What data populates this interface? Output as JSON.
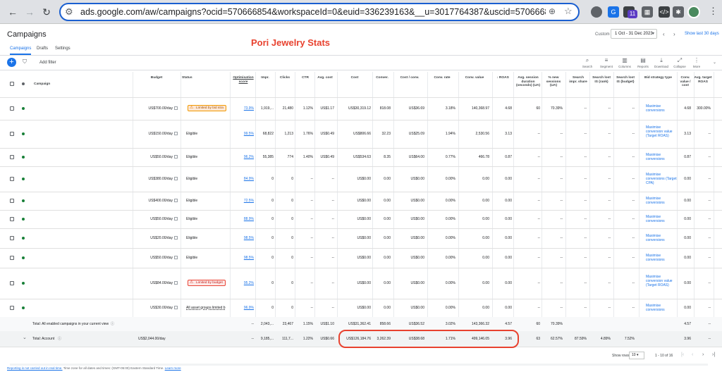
{
  "browser": {
    "url": "ads.google.com/aw/campaigns?ocid=570666854&workspaceId=0&euid=336239163&__u=3017764387&uscid=570666854&__c=88346...",
    "extension_badge": "11"
  },
  "app": {
    "title": "Campaigns",
    "overlay_title": "Pori Jewelry Stats",
    "date_custom_label": "Custom",
    "date_range": "1 Oct - 31 Dec 2023",
    "show_last_30": "Show last 30 days",
    "tabs": [
      "Campaigns",
      "Drafts",
      "Settings"
    ],
    "add_filter": "Add filter",
    "toolbar": [
      "Search",
      "Segment",
      "Columns",
      "Reports",
      "Download",
      "Collapse",
      "More"
    ]
  },
  "table": {
    "headers": {
      "campaign": "Campaign",
      "budget": "Budget",
      "status": "Status",
      "opt": "Optimisation score",
      "impr": "Impr.",
      "clicks": "Clicks",
      "ctr": "CTR",
      "cpc": "Avg. cost",
      "cost": "Cost",
      "conv": "Conver.",
      "cpa": "Cost / conv.",
      "convrate": "Conv. rate",
      "convval": "Conv. value",
      "roas": "↓ ROAS",
      "asd": "Avg. session duration (seconds) (UA)",
      "newsess": "% new sessions (UA)",
      "sis": "Search impr. share",
      "lisrank": "Search lost IS (rank)",
      "lisbudget": "Search lost IS (budget)",
      "bidstrat": "Bid strategy type",
      "cvcost": "Conv. value / cost",
      "troas": "Avg. target ROAS"
    },
    "rows": [
      {
        "budget": "US$700.00/day",
        "status": "Limited by bid stra",
        "status_type": "warn",
        "opt": "73.9%",
        "impr": "1,919,...",
        "clicks": "21,480",
        "ctr": "1.12%",
        "cpc": "US$1.17",
        "cost": "US$30,319.12",
        "conv": "818.08",
        "cpa": "US$36.69",
        "convrate": "3.18%",
        "convval": "140,368.97",
        "roas": "4.68",
        "asd": "60",
        "newsess": "70.39%",
        "sis": "--",
        "lisrank": "--",
        "lisbudget": "--",
        "bidstrat": "Maximise conversions",
        "cvcost": "4.68",
        "troas": "300.00%"
      },
      {
        "budget": "US$150.00/day",
        "status": "Eligible",
        "status_type": "plain",
        "opt": "99.5%",
        "impr": "68,822",
        "clicks": "1,213",
        "ctr": "1.76%",
        "cpc": "US$0.49",
        "cost": "US$806.66",
        "conv": "32.23",
        "cpa": "US$25.09",
        "convrate": "1.94%",
        "convval": "2,530.56",
        "roas": "3.13",
        "asd": "--",
        "newsess": "--",
        "sis": "--",
        "lisrank": "--",
        "lisbudget": "--",
        "bidstrat": "Maximise conversion value (Target ROAS)",
        "cvcost": "3.13",
        "troas": "--"
      },
      {
        "budget": "US$50.00/day",
        "status": "Eligible",
        "status_type": "plain",
        "opt": "96.2%",
        "impr": "55,385",
        "clicks": "774",
        "ctr": "1.40%",
        "cpc": "US$0.49",
        "cost": "US$534.63",
        "conv": "8.35",
        "cpa": "US$64.00",
        "convrate": "0.77%",
        "convval": "466.78",
        "roas": "0.87",
        "asd": "--",
        "newsess": "--",
        "sis": "--",
        "lisrank": "--",
        "lisbudget": "--",
        "bidstrat": "Maximise conversions",
        "cvcost": "0.87",
        "troas": "--"
      },
      {
        "budget": "US$380.00/day",
        "status": "Eligible",
        "status_type": "plain",
        "opt": "84.9%",
        "impr": "0",
        "clicks": "0",
        "ctr": "--",
        "cpc": "--",
        "cost": "US$0.00",
        "conv": "0.00",
        "cpa": "US$0.00",
        "convrate": "0.00%",
        "convval": "0.00",
        "roas": "0.00",
        "asd": "--",
        "newsess": "--",
        "sis": "--",
        "lisrank": "--",
        "lisbudget": "--",
        "bidstrat": "Maximise conversions (Target CPA)",
        "cvcost": "0.00",
        "troas": "--"
      },
      {
        "budget": "US$400.00/day",
        "status": "Eligible",
        "status_type": "plain",
        "opt": "72.5%",
        "impr": "0",
        "clicks": "0",
        "ctr": "--",
        "cpc": "--",
        "cost": "US$0.00",
        "conv": "0.00",
        "cpa": "US$0.00",
        "convrate": "0.00%",
        "convval": "0.00",
        "roas": "0.00",
        "asd": "--",
        "newsess": "--",
        "sis": "--",
        "lisrank": "--",
        "lisbudget": "--",
        "bidstrat": "Maximise conversions",
        "cvcost": "0.00",
        "troas": "--"
      },
      {
        "budget": "US$50.00/day",
        "status": "Eligible",
        "status_type": "plain",
        "opt": "88.9%",
        "impr": "0",
        "clicks": "0",
        "ctr": "--",
        "cpc": "--",
        "cost": "US$0.00",
        "conv": "0.00",
        "cpa": "US$0.00",
        "convrate": "0.00%",
        "convval": "0.00",
        "roas": "0.00",
        "asd": "--",
        "newsess": "--",
        "sis": "--",
        "lisrank": "--",
        "lisbudget": "--",
        "bidstrat": "Maximise conversions",
        "cvcost": "0.00",
        "troas": "--"
      },
      {
        "budget": "US$20.00/day",
        "status": "Eligible",
        "status_type": "plain",
        "opt": "98.5%",
        "impr": "0",
        "clicks": "0",
        "ctr": "--",
        "cpc": "--",
        "cost": "US$0.00",
        "conv": "0.00",
        "cpa": "US$0.00",
        "convrate": "0.00%",
        "convval": "0.00",
        "roas": "0.00",
        "asd": "--",
        "newsess": "--",
        "sis": "--",
        "lisrank": "--",
        "lisbudget": "--",
        "bidstrat": "Maximise conversions",
        "cvcost": "0.00",
        "troas": "--"
      },
      {
        "budget": "US$50.00/day",
        "status": "Eligible",
        "status_type": "plain",
        "opt": "98.5%",
        "impr": "0",
        "clicks": "0",
        "ctr": "--",
        "cpc": "--",
        "cost": "US$0.00",
        "conv": "0.00",
        "cpa": "US$0.00",
        "convrate": "0.00%",
        "convval": "0.00",
        "roas": "0.00",
        "asd": "--",
        "newsess": "--",
        "sis": "--",
        "lisrank": "--",
        "lisbudget": "--",
        "bidstrat": "Maximise conversions",
        "cvcost": "0.00",
        "troas": "--"
      },
      {
        "budget": "US$84.00/day",
        "status": "Limited by budget",
        "status_type": "red",
        "opt": "95.2%",
        "impr": "0",
        "clicks": "0",
        "ctr": "--",
        "cpc": "--",
        "cost": "US$0.00",
        "conv": "0.00",
        "cpa": "US$0.00",
        "convrate": "0.00%",
        "convval": "0.00",
        "roas": "0.00",
        "asd": "--",
        "newsess": "--",
        "sis": "--",
        "lisrank": "--",
        "lisbudget": "--",
        "bidstrat": "Maximise conversion value (Target ROAS)",
        "cvcost": "0.00",
        "troas": "--"
      },
      {
        "budget": "US$30.00/day",
        "status": "All asset groups limited b",
        "status_type": "underline",
        "opt": "96.9%",
        "impr": "0",
        "clicks": "0",
        "ctr": "--",
        "cpc": "--",
        "cost": "US$0.00",
        "conv": "0.00",
        "cpa": "US$0.00",
        "convrate": "0.00%",
        "convval": "0.00",
        "roas": "0.00",
        "asd": "--",
        "newsess": "--",
        "sis": "--",
        "lisrank": "--",
        "lisbudget": "--",
        "bidstrat": "Maximise conversions",
        "cvcost": "0.00",
        "troas": "--"
      }
    ],
    "total_enabled": {
      "label": "Total: All enabled campaigns in your current view",
      "budget": "",
      "opt": "--",
      "impr": "2,043,...",
      "clicks": "23,467",
      "ctr": "1.15%",
      "cpc": "US$1.10",
      "cost": "US$31,362.41",
      "conv": "858.66",
      "cpa": "US$36.52",
      "convrate": "3.02%",
      "convval": "143,366.32",
      "roas": "4.57",
      "asd": "60",
      "newsess": "70.39%",
      "sis": "",
      "lisrank": "",
      "lisbudget": "",
      "cvcost": "4.57",
      "troas": "--"
    },
    "total_account": {
      "label": "Total: Account",
      "budget": "US$2,044.00/day",
      "opt": "--",
      "impr": "9,185,...",
      "clicks": "111,7...",
      "ctr": "1.22%",
      "cpc": "US$0.66",
      "cost": "US$126,184.76",
      "conv": "3,262.39",
      "cpa": "US$38.68",
      "convrate": "1.71%",
      "convval": "499,146.05",
      "roas": "3.96",
      "asd": "63",
      "newsess": "62.57%",
      "sis": "87.59%",
      "lisrank": "4.89%",
      "lisbudget": "7.52%",
      "cvcost": "3.96",
      "troas": "--"
    }
  },
  "pager": {
    "label": "Show rows",
    "value": "10",
    "range": "1 - 10 of 16"
  },
  "footer": {
    "link1": "Reporting is not carried out in real time.",
    "text": " Time zone for all dates and times: (GMT-05:00) Eastern Standard Time.",
    "link2": "Learn more"
  },
  "colors": {
    "accent": "#1a73e8",
    "highlight": "#e8422f",
    "eligible_dot": "#188038"
  }
}
